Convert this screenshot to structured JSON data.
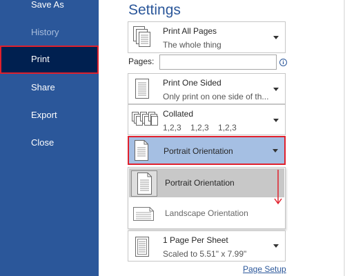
{
  "nav": {
    "items": [
      {
        "label": "Save As"
      },
      {
        "label": "History"
      },
      {
        "label": "Print"
      },
      {
        "label": "Share"
      },
      {
        "label": "Export"
      },
      {
        "label": "Close"
      }
    ]
  },
  "settings": {
    "title": "Settings",
    "print_range": {
      "title": "Print All Pages",
      "subtitle": "The whole thing"
    },
    "pages": {
      "label": "Pages:",
      "value": "",
      "info_glyph": "i"
    },
    "sides": {
      "title": "Print One Sided",
      "subtitle": "Only print on one side of th..."
    },
    "collation": {
      "title": "Collated",
      "subtitle": "1,2,3    1,2,3    1,2,3"
    },
    "orientation": {
      "title": "Portrait Orientation"
    },
    "orientation_menu": {
      "options": [
        {
          "label": "Portrait Orientation"
        },
        {
          "label": "Landscape Orientation"
        }
      ]
    },
    "per_sheet": {
      "title": "1 Page Per Sheet",
      "subtitle": "Scaled to 5.51\" x 7.99\""
    },
    "page_setup_link": "Page Setup"
  },
  "colors": {
    "accent": "#2b579a",
    "nav_active": "#002050",
    "highlight_border": "#e0202c",
    "selected_fill": "#a5bfe3"
  }
}
